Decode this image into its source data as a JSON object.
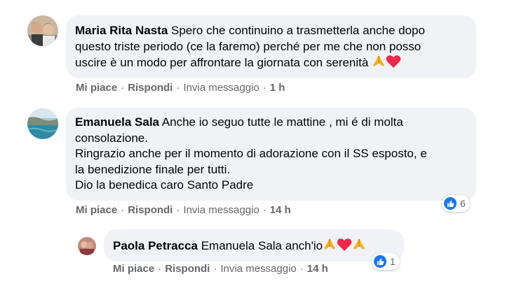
{
  "comments": [
    {
      "author": "Maria Rita Nasta",
      "lines": [
        "Spero che continuino a trasmetterla anche dopo",
        "questo triste periodo (ce la faremo) perché per me che non posso",
        "uscire è un modo per affrontare la giornata con serenità"
      ],
      "emojis": [
        "folded-hands",
        "red-heart"
      ],
      "actions": {
        "like": "Mi piace",
        "reply": "Rispondi",
        "message": "Invia messaggio",
        "time": "1 h"
      }
    },
    {
      "author": "Emanuela Sala",
      "lines": [
        "Anche io seguo tutte le mattine , mi é di molta",
        "consolazione.",
        "Ringrazio anche per il momento di adorazione con il SS esposto, e",
        "la benedizione finale per tutti.",
        "Dio la benedica caro Santo Padre"
      ],
      "reaction_count": "6",
      "actions": {
        "like": "Mi piace",
        "reply": "Rispondi",
        "message": "Invia messaggio",
        "time": "14 h"
      }
    },
    {
      "author": "Paola Petracca",
      "mention": "Emanuela Sala",
      "text": "anch'io",
      "emojis": [
        "folded-hands",
        "red-heart",
        "folded-hands"
      ],
      "reaction_count": "1",
      "actions": {
        "like": "Mi piace",
        "reply": "Rispondi",
        "message": "Invia messaggio",
        "time": "14 h"
      }
    }
  ],
  "colors": {
    "bubble": "#f0f2f5",
    "secondary_text": "#65676b",
    "like_blue": "#1877f2",
    "heart_red": "#f02849"
  }
}
